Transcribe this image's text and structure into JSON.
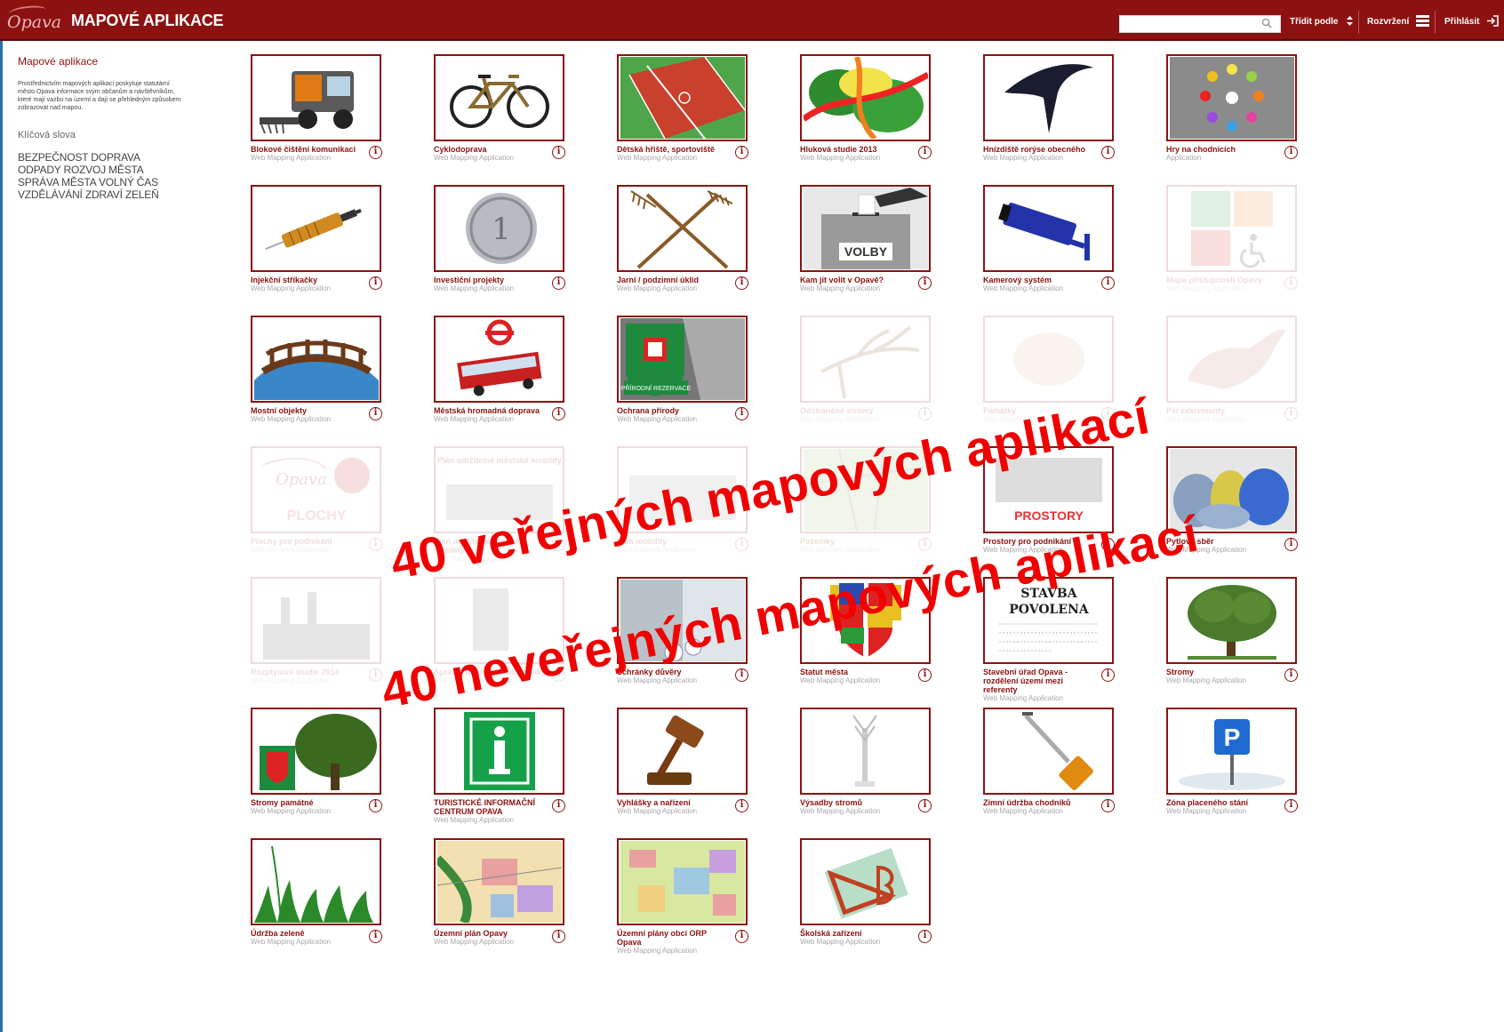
{
  "header": {
    "logo_text": "Opava",
    "title": "MAPOVÉ APLIKACE",
    "search_placeholder": "",
    "sort_label": "Třídit podle",
    "view_label": "Rozvržení",
    "login_label": "Přihlásit"
  },
  "sidebar": {
    "title": "Mapové aplikace",
    "description": "Prostřednictvím mapových aplikací poskytuje statutární město Opava informace svým občanům a návštěvníkům, které mají vazbu na území a dají se přehledným způsobem zobrazovat nad mapou.",
    "keywords_title": "Klíčová slova",
    "keywords": "BEZPEČNOST DOPRAVA ODPADY ROZVOJ MĚSTA SPRÁVA MĚSTA VOLNÝ ČAS VZDĚLÁVÁNÍ ZDRAVÍ ZELEŇ"
  },
  "apps": [
    {
      "name": "Blokové čištění komunikací",
      "type": "Web Mapping Application",
      "icon": "street-sweeper-icon",
      "faded": false
    },
    {
      "name": "Cyklodoprava",
      "type": "Web Mapping Application",
      "icon": "bicycle-icon",
      "faded": false
    },
    {
      "name": "Dětská hřiště, sportoviště",
      "type": "Web Mapping Application",
      "icon": "sports-field-icon",
      "faded": false
    },
    {
      "name": "Hluková studie 2013",
      "type": "Web Mapping Application",
      "icon": "noise-map-icon",
      "faded": false
    },
    {
      "name": "Hnízdiště rorýse obecného",
      "type": "Web Mapping Application",
      "icon": "swift-bird-icon",
      "faded": false
    },
    {
      "name": "Hry na chodnících",
      "type": "Application",
      "icon": "sidewalk-game-icon",
      "faded": false
    },
    {
      "name": "Injekční stříkačky",
      "type": "Web Mapping Application",
      "icon": "syringe-icon",
      "faded": false
    },
    {
      "name": "Investiční projekty",
      "type": "Web Mapping Application",
      "icon": "coin-icon",
      "faded": false
    },
    {
      "name": "Jarní / podzimní úklid",
      "type": "Web Mapping Application",
      "icon": "rakes-icon",
      "faded": false
    },
    {
      "name": "Kam jít volit v Opavě?",
      "type": "Web Mapping Application",
      "icon": "ballot-box-icon",
      "faded": false
    },
    {
      "name": "Kamerový systém",
      "type": "Web Mapping Application",
      "icon": "camera-icon",
      "faded": false
    },
    {
      "name": "Mapa přístupnosti Opavy",
      "type": "Web Mapping Application",
      "icon": "accessibility-icon",
      "faded": true
    },
    {
      "name": "Mostní objekty",
      "type": "Web Mapping Application",
      "icon": "bridge-icon",
      "faded": false
    },
    {
      "name": "Městská hromadná doprava",
      "type": "Web Mapping Application",
      "icon": "trolleybus-icon",
      "faded": false
    },
    {
      "name": "Ochrana přírody",
      "type": "Web Mapping Application",
      "icon": "nature-reserve-icon",
      "faded": false
    },
    {
      "name": "Odstraněné stromy",
      "type": "Web Mapping Application",
      "icon": "branch-icon",
      "faded": true
    },
    {
      "name": "Památky",
      "type": "Web Mapping Application",
      "icon": "monument-icon",
      "faded": true
    },
    {
      "name": "Psí exkrementy",
      "type": "Web Mapping Application",
      "icon": "dog-icon",
      "faded": true
    },
    {
      "name": "Plochy pro podnikání",
      "type": "Web Mapping Application",
      "icon": "plochy-icon",
      "faded": true
    },
    {
      "name": "Plán udržitelné městské mobility",
      "type": "Web Mapping Application",
      "icon": "mobility-plan-icon",
      "faded": true
    },
    {
      "name": "Plán mobility",
      "type": "Web Mapping Application",
      "icon": "city-icon",
      "faded": true
    },
    {
      "name": "Pozemky",
      "type": "Web Mapping Application",
      "icon": "parcels-icon",
      "faded": true
    },
    {
      "name": "Prostory pro podnikání",
      "type": "Web Mapping Application",
      "icon": "prostory-icon",
      "faded": false
    },
    {
      "name": "Pytlový sběr",
      "type": "Web Mapping Application",
      "icon": "bags-icon",
      "faded": false
    },
    {
      "name": "Rozptylová studie 2014",
      "type": "Web Mapping Application",
      "icon": "factory-icon",
      "faded": true
    },
    {
      "name": "Správní úřady a územní celky",
      "type": "Web Mapping Application",
      "icon": "office-icon",
      "faded": true
    },
    {
      "name": "Schránky důvěry",
      "type": "Web Mapping Application",
      "icon": "mailbox-icon",
      "faded": false
    },
    {
      "name": "Statut města",
      "type": "Web Mapping Application",
      "icon": "coat-of-arms-icon",
      "faded": false
    },
    {
      "name": "Stavební úřad Opava - rozdělení území mezi referenty",
      "type": "Web Mapping Application",
      "icon": "building-permit-icon",
      "faded": false
    },
    {
      "name": "Stromy",
      "type": "Web Mapping Application",
      "icon": "tree-icon",
      "faded": false
    },
    {
      "name": "Stromy památné",
      "type": "Web Mapping Application",
      "icon": "memorial-tree-icon",
      "faded": false
    },
    {
      "name": "TURISTICKÉ INFORMAČNÍ CENTRUM OPAVA",
      "type": "Web Mapping Application",
      "icon": "info-sign-icon",
      "faded": false
    },
    {
      "name": "Vyhlášky a nařízení",
      "type": "Web Mapping Application",
      "icon": "gavel-icon",
      "faded": false
    },
    {
      "name": "Výsadby stromů",
      "type": "Web Mapping Application",
      "icon": "sapling-icon",
      "faded": false
    },
    {
      "name": "Zimní údržba chodníků",
      "type": "Web Mapping Application",
      "icon": "shovel-icon",
      "faded": false
    },
    {
      "name": "Zóna placeného stání",
      "type": "Web Mapping Application",
      "icon": "parking-icon",
      "faded": false
    },
    {
      "name": "Údržba zeleně",
      "type": "Web Mapping Application",
      "icon": "grass-icon",
      "faded": false
    },
    {
      "name": "Územní plán Opavy",
      "type": "Web Mapping Application",
      "icon": "zoning-map-icon",
      "faded": false
    },
    {
      "name": "Územní plány obcí ORP Opava",
      "type": "Web Mapping Application",
      "icon": "cadastral-map-icon",
      "faded": false
    },
    {
      "name": "Školská zařízení",
      "type": "Web Mapping Application",
      "icon": "set-square-icon",
      "faded": false
    }
  ],
  "overlay": {
    "line1": "40 veřejných mapových aplikací",
    "line2": "40 neveřejných mapových aplikací",
    "color": "#f00000"
  },
  "colors": {
    "brand": "#8c1111",
    "muted": "#a8a8a8"
  },
  "thumb_text": {
    "volby": "VOLBY",
    "plochy": "PLOCHY",
    "prostory": "PROSTORY",
    "stavba": "STAVBA POVOLENA",
    "mobility": "Plán udržitelné městské mobility",
    "reserve": "PŘÍRODNÍ REZERVACE"
  }
}
